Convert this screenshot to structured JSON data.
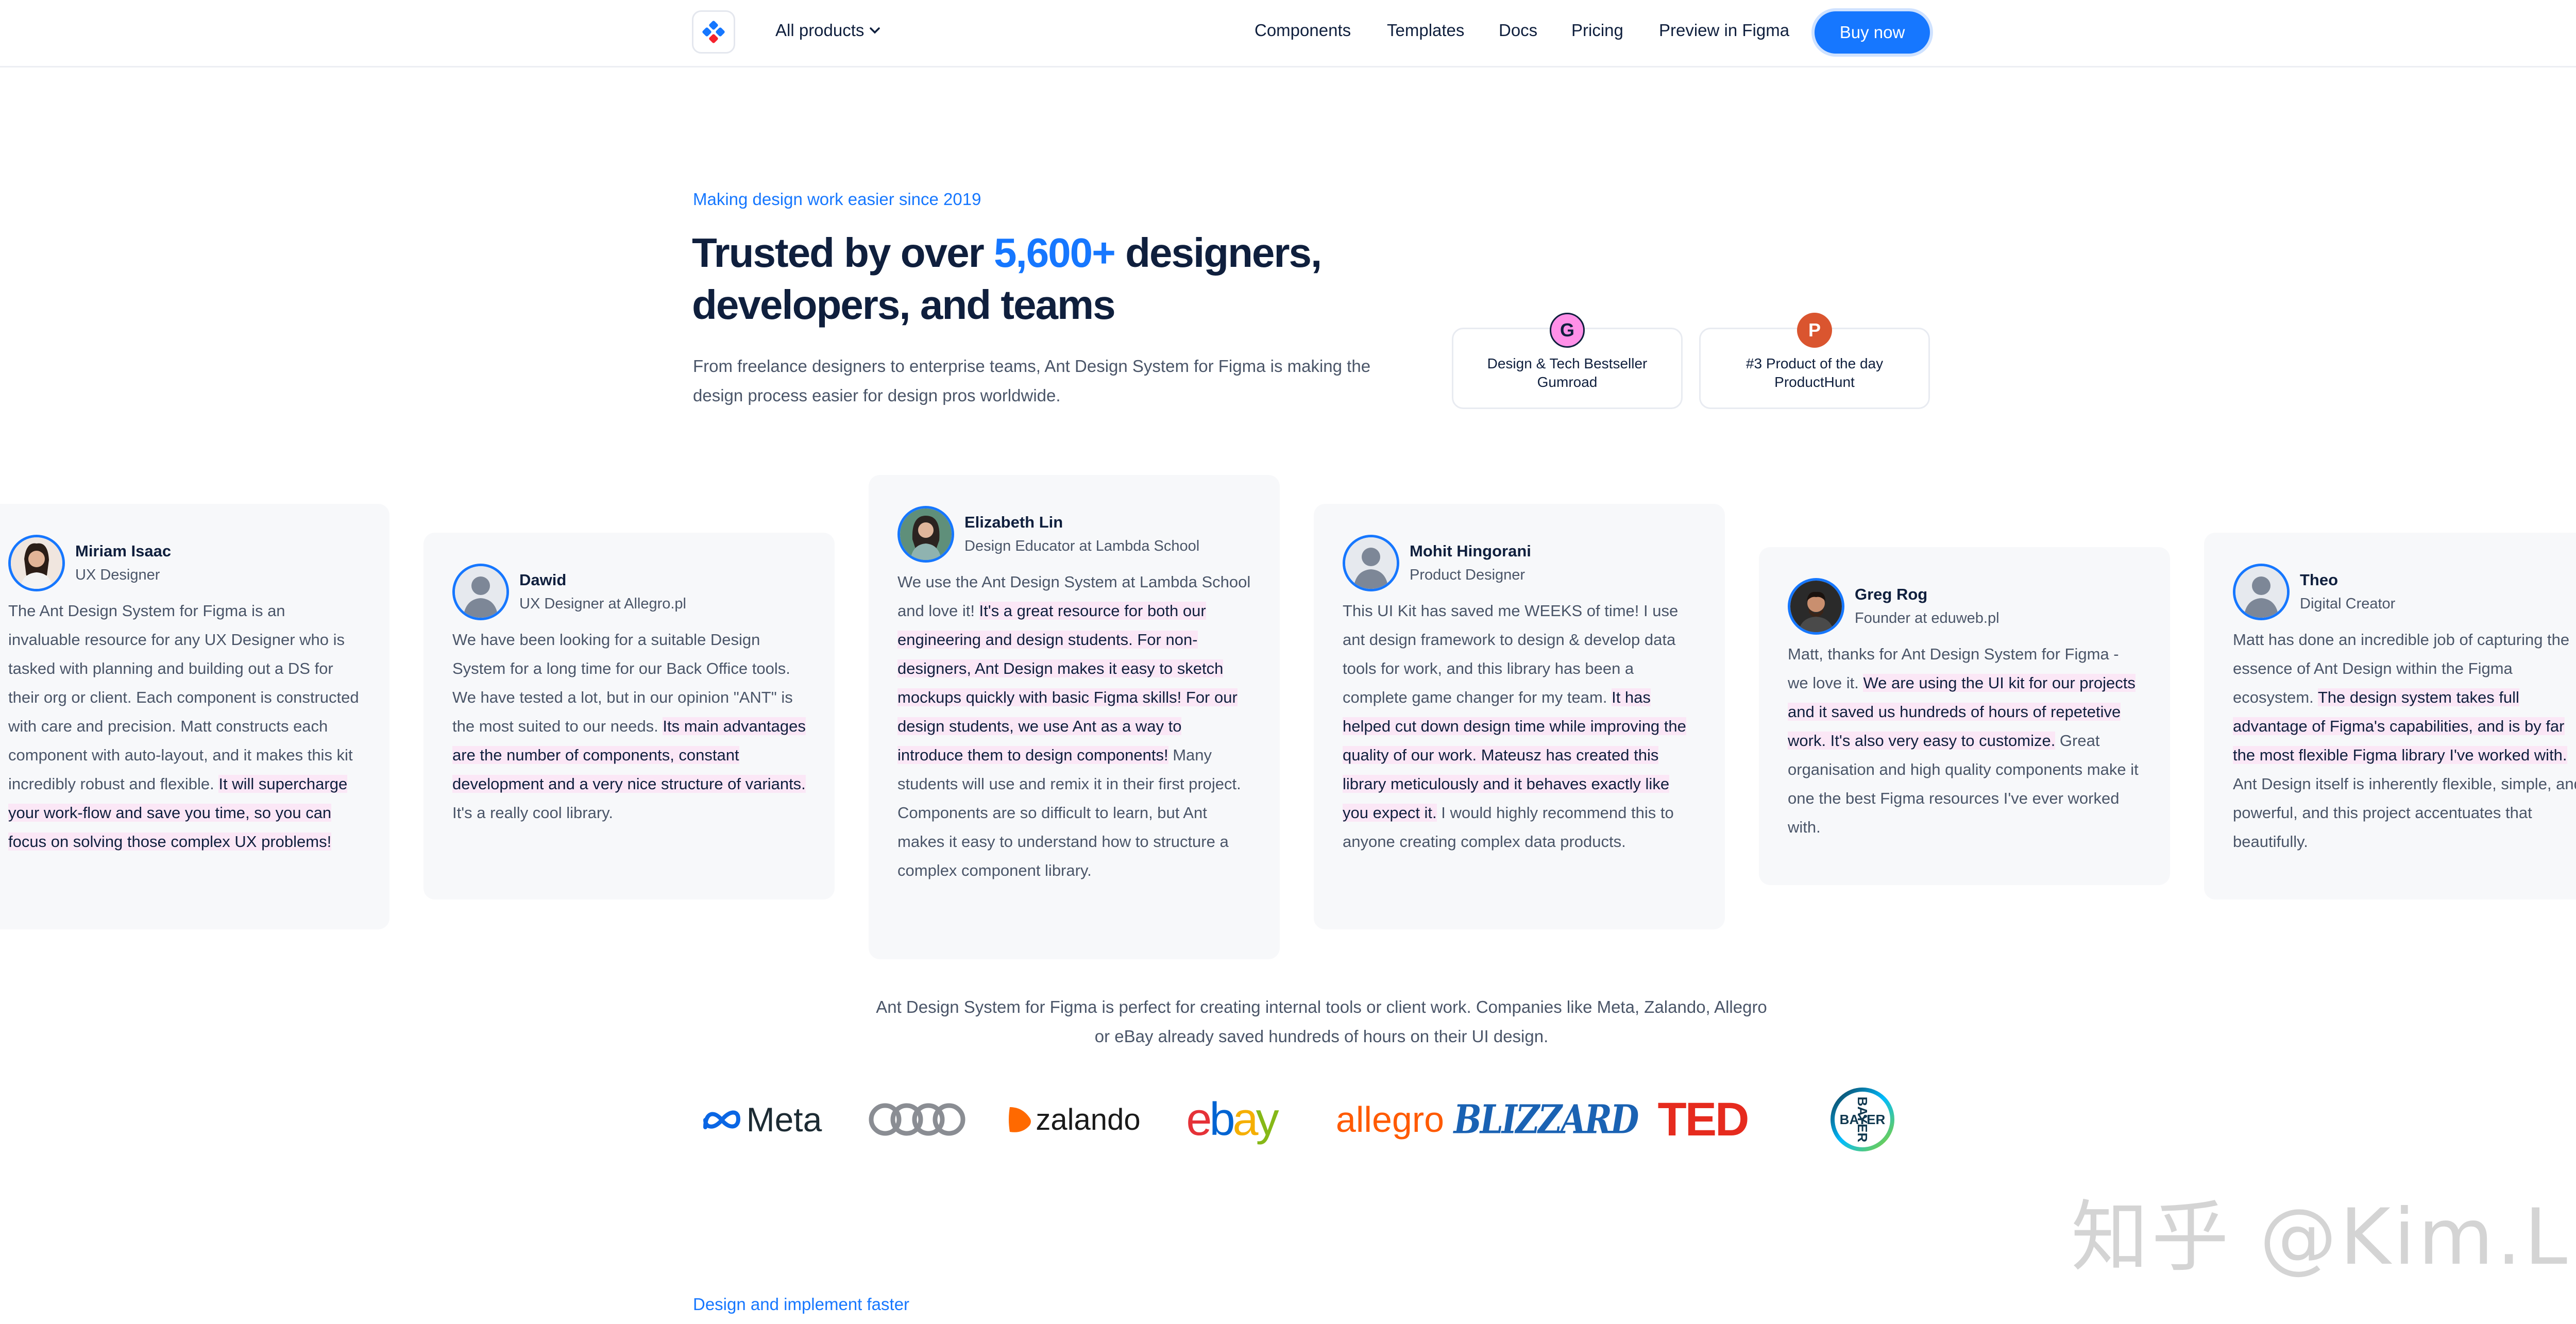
{
  "nav": {
    "products_label": "All products",
    "links": [
      "Components",
      "Templates",
      "Docs",
      "Pricing",
      "Preview in Figma"
    ],
    "buy_label": "Buy now"
  },
  "hero": {
    "eyebrow": "Making design work easier since 2019",
    "headline_pre": "Trusted by over ",
    "headline_accent": "5,600+",
    "headline_post": " designers, developers, and teams",
    "description": "From freelance designers to enterprise teams, Ant Design System for Figma is making the design process easier for design pros worldwide.",
    "awards": [
      {
        "badge": "G",
        "line1": "Design & Tech Bestseller",
        "line2": "Gumroad",
        "color": "#ff90e8"
      },
      {
        "badge": "P",
        "line1": "#3 Product of the day",
        "line2": "ProductHunt",
        "color": "#da552f"
      }
    ]
  },
  "testimonials": [
    {
      "name": "Miriam Isaac",
      "role": "UX Designer",
      "quote_plain": "The Ant Design System for Figma is an invaluable resource for any UX Designer who is tasked with planning and building out a DS for their org or client. Each component is constructed with care and precision. Matt constructs each component with auto-layout, and it makes this kit incredibly robust and flexible. ",
      "quote_hl": "It will supercharge your work-flow and save you time, so you can focus on solving those complex UX problems!",
      "quote_tail": ""
    },
    {
      "name": "Dawid",
      "role": "UX Designer at Allegro.pl",
      "quote_plain": "We have been looking for a suitable Design System for a long time for our Back Office tools. We have tested a lot, but in our opinion \"ANT\" is the most suited to our needs. ",
      "quote_hl": "Its main advantages are the number of components, constant development and a very nice structure of variants.",
      "quote_tail": " It's a really cool library."
    },
    {
      "name": "Elizabeth Lin",
      "role": "Design Educator at Lambda School",
      "quote_plain": "We use the Ant Design System at Lambda School and love it! ",
      "quote_hl": "It's a great resource for both our engineering and design students. For non-designers, Ant Design makes it easy to sketch mockups quickly with basic Figma skills! For our design students, we use Ant as a way to introduce them to design components!",
      "quote_tail": " Many students will use and remix it in their first project. Components are so difficult to learn, but Ant makes it easy to understand how to structure a complex component library."
    },
    {
      "name": "Mohit Hingorani",
      "role": "Product Designer",
      "quote_plain": "This UI Kit has saved me WEEKS of time! I use ant design framework to design & develop data tools for work, and this library has been a complete game changer for my team. ",
      "quote_hl": "It has helped cut down design time while improving the quality of our work. Mateusz has created this library meticulously and it behaves exactly like you expect it.",
      "quote_tail": " I would highly recommend this to anyone creating complex data products."
    },
    {
      "name": "Greg Rog",
      "role": "Founder at eduweb.pl",
      "quote_plain": "Matt, thanks for Ant Design System for Figma - we love it. ",
      "quote_hl": "We are using the UI kit for our projects and it saved us hundreds of hours of repetetive work. It's also very easy to customize.",
      "quote_tail": " Great organisation and high quality components make it one the best Figma resources I've ever worked with."
    },
    {
      "name": "Theo",
      "role": "Digital Creator",
      "quote_plain": "Matt has done an incredible job of capturing the essence of Ant Design within the Figma ecosystem. ",
      "quote_hl": "The design system takes full advantage of Figma's capabilities, and is by far the most flexible Figma library I've worked with.",
      "quote_tail": " Ant Design itself is inherently flexible, simple, and powerful, and this project accentuates that beautifully."
    }
  ],
  "companies": {
    "text": "Ant Design System for Figma is perfect for creating internal tools or client work. Companies like Meta, Zalando, Allegro or eBay already saved hundreds of hours on their UI design.",
    "logos": [
      "Meta",
      "zalando",
      "ebay",
      "allegro",
      "BLIZZARD",
      "TED",
      "BAYER"
    ]
  },
  "next_section": {
    "eyebrow": "Design and implement faster"
  },
  "watermark": "知乎 @Kim.Li",
  "colors": {
    "accent": "#1677ff",
    "ink": "#0f1f3d",
    "muted": "#4a5568",
    "highlight": "#fbe7f6"
  }
}
